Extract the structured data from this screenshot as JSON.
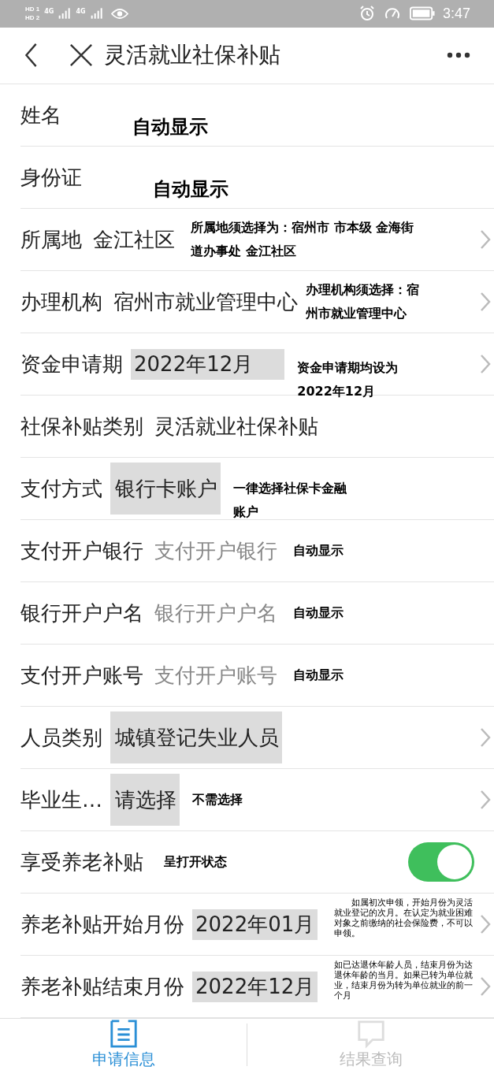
{
  "status_bar": {
    "sim_labels": [
      "HD 1",
      "HD 2"
    ],
    "network": [
      "4G",
      "4G"
    ],
    "time": "3:47"
  },
  "header": {
    "title": "灵活就业社保补贴"
  },
  "rows": [
    {
      "label": "姓名",
      "kind": "input",
      "note": "自动显示"
    },
    {
      "label": "身份证",
      "kind": "input",
      "note": "自动显示"
    },
    {
      "label": "所属地",
      "kind": "select",
      "value": "金江社区",
      "note": "所属地须选择为：宿州市  市本级 金海街道办事处  金江社区"
    },
    {
      "label": "办理机构",
      "kind": "select",
      "value": "宿州市就业管理中心",
      "note": "办理机构须选择：宿州市就业管理中心"
    },
    {
      "label": "资金申请期",
      "kind": "select",
      "value": "2022年12月",
      "note": "资金申请期均设为2022年12月"
    },
    {
      "label": "社保补贴类别",
      "kind": "input",
      "value": "灵活就业社保补贴"
    },
    {
      "label": "支付方式",
      "kind": "input",
      "value": "银行卡账户",
      "note": "一律选择社保卡金融账户"
    },
    {
      "label": "支付开户银行",
      "kind": "input",
      "placeholder": "支付开户银行",
      "note": "自动显示"
    },
    {
      "label": "银行开户户名",
      "kind": "input",
      "placeholder": "银行开户户名",
      "note": "自动显示"
    },
    {
      "label": "支付开户账号",
      "kind": "input",
      "placeholder": "支付开户账号",
      "note": "自动显示"
    },
    {
      "label": "人员类别",
      "kind": "select",
      "value": "城镇登记失业人员"
    },
    {
      "label": "毕业生…",
      "kind": "select",
      "value": "请选择",
      "note": "不需选择"
    },
    {
      "label": "享受养老补贴",
      "kind": "toggle",
      "on": true,
      "note": "呈打开状态"
    },
    {
      "label": "养老补贴开始月份",
      "kind": "select",
      "value": "2022年01月",
      "note": "　　如属初次申领，开始月份为灵活就业登记的次月。在认定为就业困难对象之前缴纳的社会保险费，不可以申领。"
    },
    {
      "label": "养老补贴结束月份",
      "kind": "select",
      "value": "2022年12月",
      "note": "如已达退休年龄人员，结束月份为达退休年龄的当月。如果已转为单位就业，结束月份为转为单位就业的前一个月"
    }
  ],
  "tabs": [
    {
      "label": "申请信息",
      "selected": true
    },
    {
      "label": "结果查询",
      "selected": false
    }
  ]
}
